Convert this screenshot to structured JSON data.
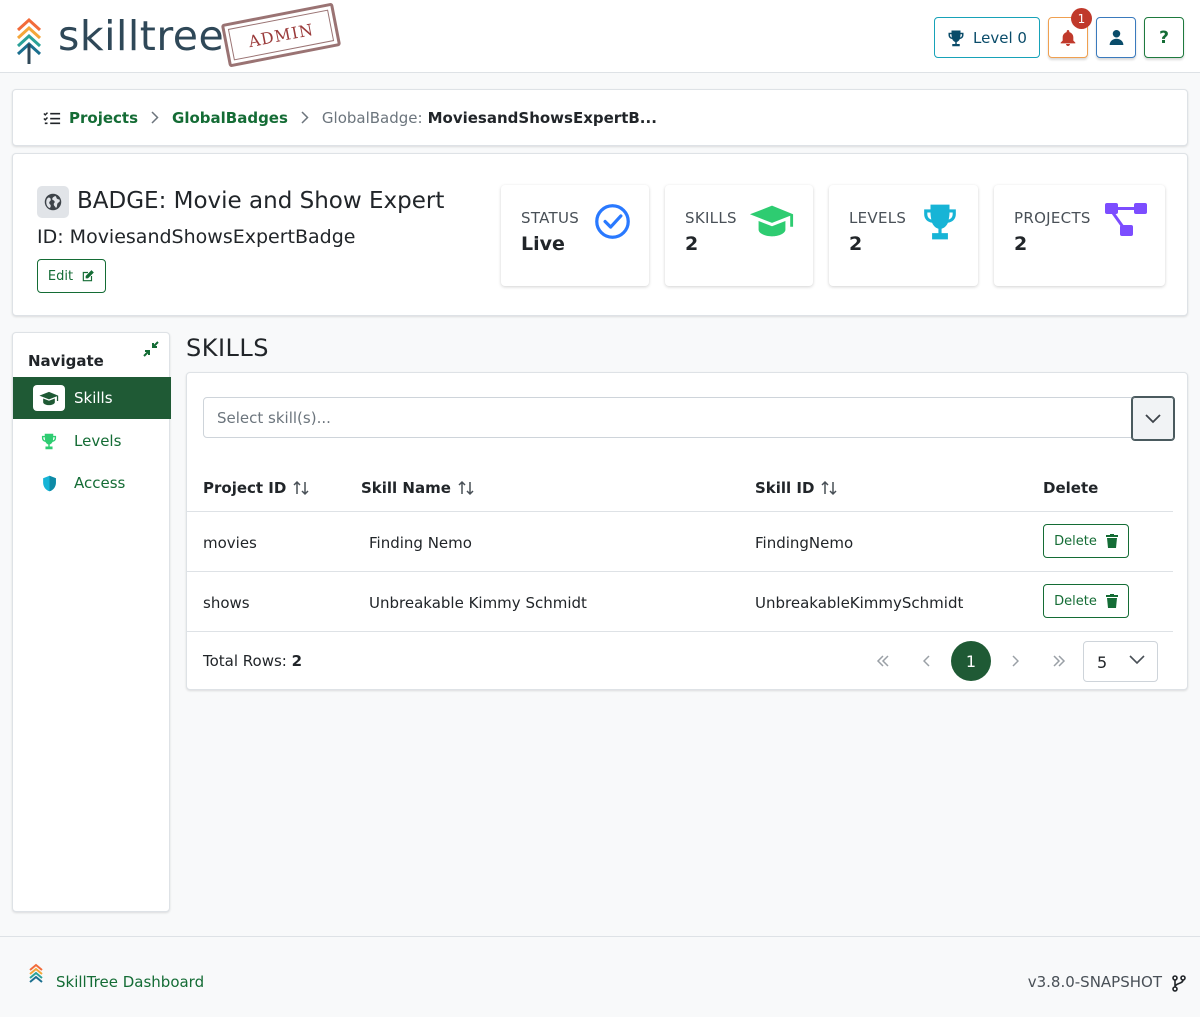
{
  "header": {
    "brand": "skilltree",
    "stamp": "ADMIN",
    "level_label": "Level 0",
    "notification_count": "1",
    "help_label": "?"
  },
  "breadcrumb": {
    "projects": "Projects",
    "global_badges": "GlobalBadges",
    "current_prefix": "GlobalBadge:",
    "current_value": "MoviesandShowsExpertB..."
  },
  "badge": {
    "title": "BADGE: Movie and Show Expert",
    "id_line": "ID: MoviesandShowsExpertBadge",
    "edit_label": "Edit",
    "stats": [
      {
        "label": "STATUS",
        "value": "Live",
        "icon": "check-circle-icon",
        "color": "#2979ff"
      },
      {
        "label": "SKILLS",
        "value": "2",
        "icon": "graduation-cap-icon",
        "color": "#2ecc71"
      },
      {
        "label": "LEVELS",
        "value": "2",
        "icon": "trophy-icon",
        "color": "#17b4d6"
      },
      {
        "label": "PROJECTS",
        "value": "2",
        "icon": "project-diagram-icon",
        "color": "#7c4dff"
      }
    ]
  },
  "nav": {
    "title": "Navigate",
    "items": [
      {
        "label": "Skills",
        "icon": "graduation-cap-icon",
        "active": true
      },
      {
        "label": "Levels",
        "icon": "trophy-icon",
        "active": false
      },
      {
        "label": "Access",
        "icon": "shield-icon",
        "active": false
      }
    ]
  },
  "skills": {
    "title": "SKILLS",
    "select_placeholder": "Select skill(s)...",
    "columns": [
      "Project ID",
      "Skill Name",
      "Skill ID",
      "Delete"
    ],
    "rows": [
      {
        "project_id": "movies",
        "skill_name": "Finding Nemo",
        "skill_id": "FindingNemo",
        "delete_label": "Delete"
      },
      {
        "project_id": "shows",
        "skill_name": "Unbreakable Kimmy Schmidt",
        "skill_id": "UnbreakableKimmySchmidt",
        "delete_label": "Delete"
      }
    ],
    "total_label": "Total Rows:",
    "total_value": "2",
    "pagination": {
      "current_page": "1",
      "per_page": "5"
    }
  },
  "footer": {
    "title": "SkillTree Dashboard",
    "version": "v3.8.0-SNAPSHOT"
  },
  "colors": {
    "primary": "#146c35",
    "primary_dark": "#1f5a35",
    "info": "#17a2b8",
    "warning": "#f0a050",
    "danger": "#c0392b"
  }
}
